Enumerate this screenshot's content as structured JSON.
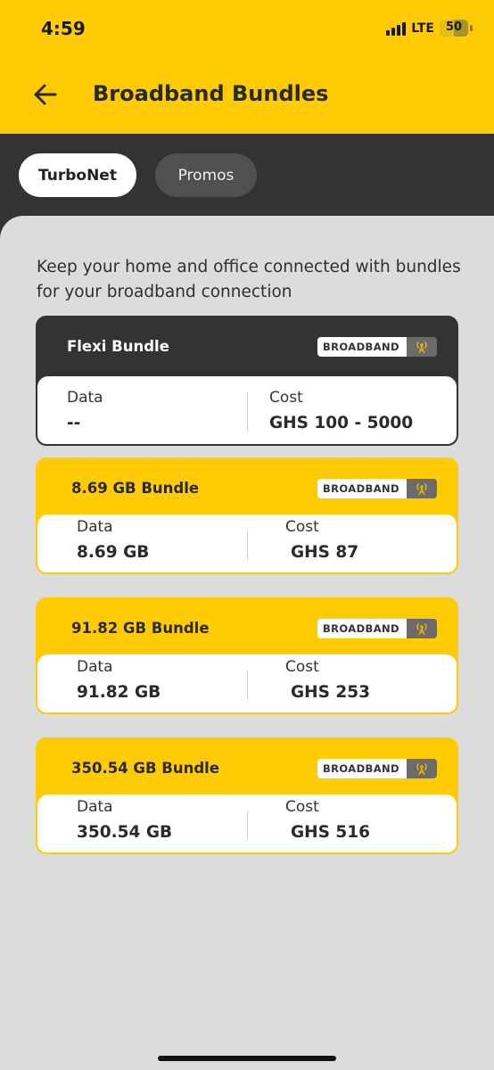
{
  "status_bar": {
    "time": "4:59",
    "network": "LTE",
    "battery": "50",
    "battery_level": 0.5
  },
  "header": {
    "back_icon": "arrow-left-icon",
    "title": "Broadband Bundles",
    "background": "#ffcb05"
  },
  "tabs": [
    {
      "label": "TurboNet",
      "active": true
    },
    {
      "label": "Promos",
      "active": false
    }
  ],
  "intro_text": "Keep your home and office connected with bundles for your broadband connection",
  "bundles": [
    {
      "name": "Flexi Bundle",
      "badge": "BROADBAND",
      "badge_icon": "broadband-antenna-icon",
      "data_label": "Data",
      "data_value": "--",
      "cost_label": "Cost",
      "cost_value": "GHS  100 - 5000",
      "style": "dark"
    },
    {
      "name": "8.69 GB  Bundle",
      "badge": "BROADBAND",
      "badge_icon": "broadband-antenna-icon",
      "data_label": "Data",
      "data_value": "8.69 GB",
      "cost_label": "Cost",
      "cost_value": "GHS 87",
      "style": "yellow"
    },
    {
      "name": "91.82 GB  Bundle",
      "badge": "BROADBAND",
      "badge_icon": "broadband-antenna-icon",
      "data_label": "Data",
      "data_value": "91.82 GB",
      "cost_label": "Cost",
      "cost_value": "GHS 253",
      "style": "yellow"
    },
    {
      "name": "350.54 GB  Bundle",
      "badge": "BROADBAND",
      "badge_icon": "broadband-antenna-icon",
      "data_label": "Data",
      "data_value": "350.54 GB",
      "cost_label": "Cost",
      "cost_value": "GHS 516",
      "style": "yellow"
    }
  ],
  "colors": {
    "brand_yellow": "#ffcb05",
    "dark": "#333333",
    "background": "#dcdcdc"
  }
}
